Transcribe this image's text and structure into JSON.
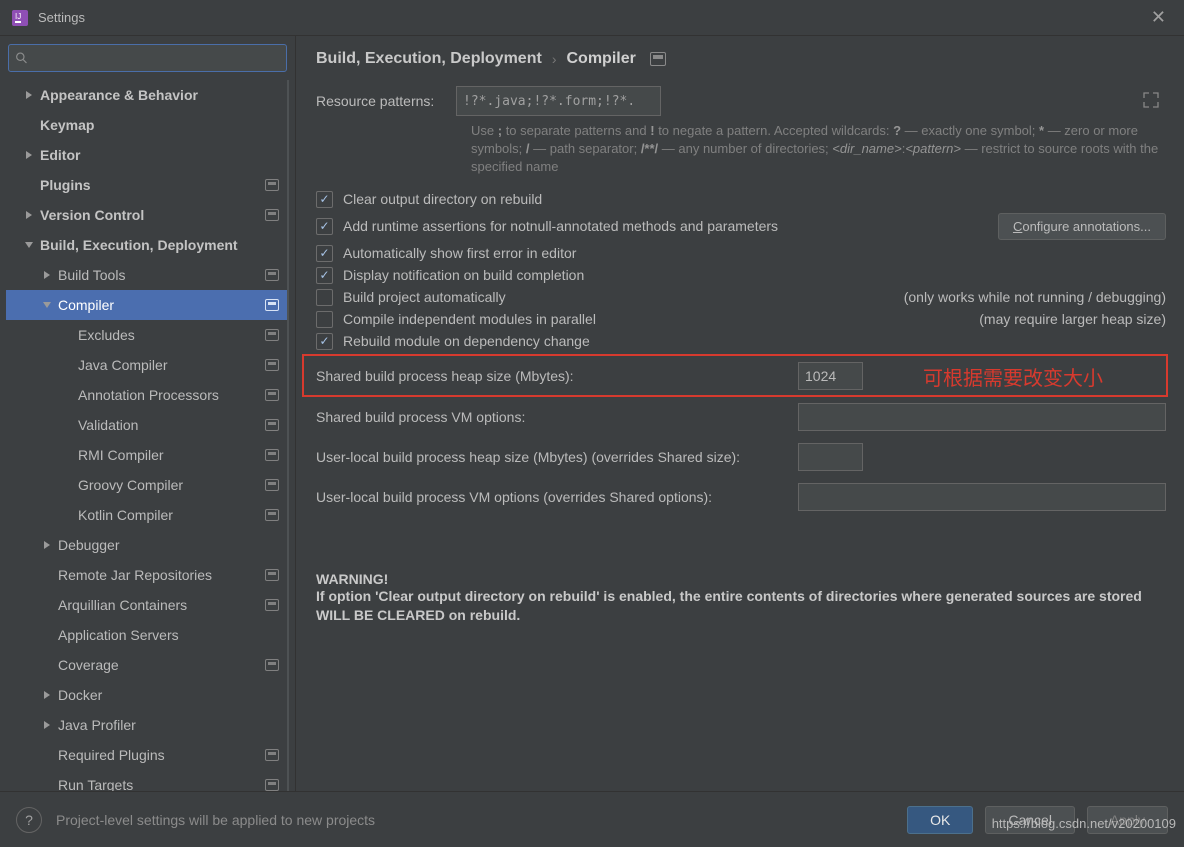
{
  "window": {
    "title": "Settings"
  },
  "search": {
    "placeholder": ""
  },
  "sidebar": {
    "items": [
      {
        "label": "Appearance & Behavior",
        "level": 0,
        "bold": true,
        "expand": "right"
      },
      {
        "label": "Keymap",
        "level": 0,
        "bold": true
      },
      {
        "label": "Editor",
        "level": 0,
        "bold": true,
        "expand": "right"
      },
      {
        "label": "Plugins",
        "level": 0,
        "bold": true,
        "project": true
      },
      {
        "label": "Version Control",
        "level": 0,
        "bold": true,
        "expand": "right",
        "project": true
      },
      {
        "label": "Build, Execution, Deployment",
        "level": 0,
        "bold": true,
        "expand": "down"
      },
      {
        "label": "Build Tools",
        "level": 1,
        "expand": "right",
        "project": true
      },
      {
        "label": "Compiler",
        "level": 1,
        "expand": "down",
        "project": true,
        "selected": true
      },
      {
        "label": "Excludes",
        "level": 2,
        "project": true
      },
      {
        "label": "Java Compiler",
        "level": 2,
        "project": true
      },
      {
        "label": "Annotation Processors",
        "level": 2,
        "project": true
      },
      {
        "label": "Validation",
        "level": 2,
        "project": true
      },
      {
        "label": "RMI Compiler",
        "level": 2,
        "project": true
      },
      {
        "label": "Groovy Compiler",
        "level": 2,
        "project": true
      },
      {
        "label": "Kotlin Compiler",
        "level": 2,
        "project": true
      },
      {
        "label": "Debugger",
        "level": 1,
        "expand": "right"
      },
      {
        "label": "Remote Jar Repositories",
        "level": 1,
        "project": true
      },
      {
        "label": "Arquillian Containers",
        "level": 1,
        "project": true
      },
      {
        "label": "Application Servers",
        "level": 1
      },
      {
        "label": "Coverage",
        "level": 1,
        "project": true
      },
      {
        "label": "Docker",
        "level": 1,
        "expand": "right"
      },
      {
        "label": "Java Profiler",
        "level": 1,
        "expand": "right"
      },
      {
        "label": "Required Plugins",
        "level": 1,
        "project": true
      },
      {
        "label": "Run Targets",
        "level": 1,
        "project": true
      }
    ]
  },
  "breadcrumb": {
    "a": "Build, Execution, Deployment",
    "b": "Compiler"
  },
  "patterns": {
    "label": "Resource patterns:",
    "value": "!?*.java;!?*.form;!?*.class;!?*.groovy;!?*.scala;!?*.flex;!?*.kt;!?*.clj;!?*.aj",
    "hint": "Use ; to separate patterns and ! to negate a pattern. Accepted wildcards: ? — exactly one symbol; * — zero or more symbols; / — path separator; /**/ — any number of directories; <dir_name>:<pattern> — restrict to source roots with the specified name"
  },
  "checks": {
    "clear": {
      "label": "Clear output directory on rebuild",
      "checked": true
    },
    "assert": {
      "label": "Add runtime assertions for notnull-annotated methods and parameters",
      "checked": true,
      "button": "Configure annotations..."
    },
    "auto_err": {
      "label": "Automatically show first error in editor",
      "checked": true
    },
    "notify": {
      "label": "Display notification on build completion",
      "checked": true
    },
    "auto_build": {
      "label": "Build project automatically",
      "checked": false,
      "note": "(only works while not running / debugging)"
    },
    "parallel": {
      "label": "Compile independent modules in parallel",
      "checked": false,
      "note": "(may require larger heap size)"
    },
    "rebuild_dep": {
      "label": "Rebuild module on dependency change",
      "checked": true
    }
  },
  "fields": {
    "heap": {
      "label": "Shared build process heap size (Mbytes):",
      "value": "1024"
    },
    "vm": {
      "label": "Shared build process VM options:",
      "value": ""
    },
    "uheap": {
      "label": "User-local build process heap size (Mbytes) (overrides Shared size):",
      "value": ""
    },
    "uvm": {
      "label": "User-local build process VM options (overrides Shared options):",
      "value": ""
    }
  },
  "annotation": {
    "text": "可根据需要改变大小"
  },
  "warning": {
    "head": "WARNING!",
    "text": "If option 'Clear output directory on rebuild' is enabled, the entire contents of directories where generated sources are stored WILL BE CLEARED on rebuild."
  },
  "footer": {
    "msg": "Project-level settings will be applied to new projects",
    "ok": "OK",
    "cancel": "Cancel",
    "apply": "Apply"
  },
  "watermark": "https://blog.csdn.net/v20200109"
}
